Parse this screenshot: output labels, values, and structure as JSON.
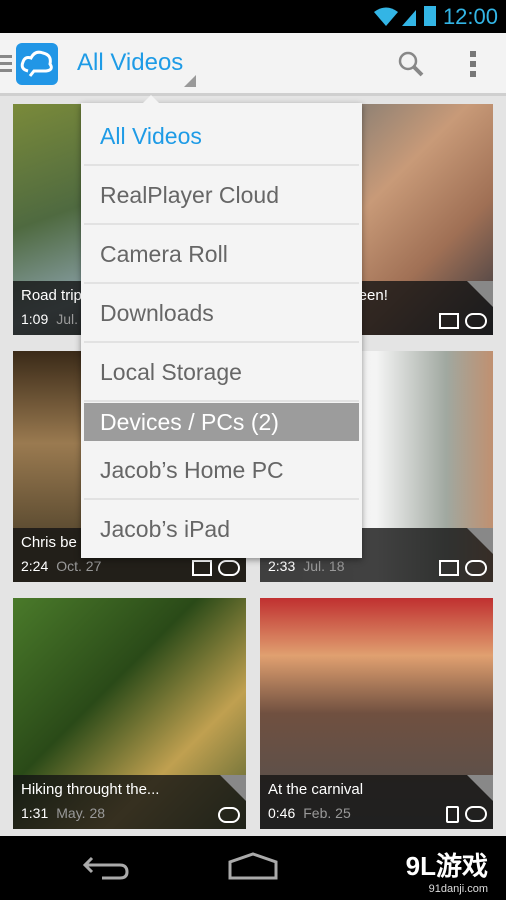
{
  "status": {
    "time": "12:00",
    "icons": [
      "wifi-icon",
      "signal-icon",
      "battery-icon"
    ]
  },
  "actionbar": {
    "title": "All Videos",
    "icons": [
      "menu-icon",
      "cloud-logo-icon",
      "search-icon",
      "overflow-icon"
    ]
  },
  "menu": {
    "items": [
      {
        "label": "All Videos",
        "selected": true
      },
      {
        "label": "RealPlayer Cloud"
      },
      {
        "label": "Camera Roll"
      },
      {
        "label": "Downloads"
      },
      {
        "label": "Local Storage"
      },
      {
        "label": "Devices / PCs (2)",
        "header": true
      },
      {
        "label": "Jacob’s Home PC"
      },
      {
        "label": "Jacob’s iPad"
      }
    ]
  },
  "videos": [
    {
      "title": "Road trip",
      "duration": "1:09",
      "date": "Jul."
    },
    {
      "title": "queen!",
      "duration": "",
      "date": ""
    },
    {
      "title": "Chris be",
      "duration": "2:24",
      "date": "Oct. 27"
    },
    {
      "title": "",
      "duration": "2:33",
      "date": "Jul. 18"
    },
    {
      "title": "Hiking throught the...",
      "duration": "1:31",
      "date": "May. 28"
    },
    {
      "title": "At the carnival",
      "duration": "0:46",
      "date": "Feb. 25"
    }
  ],
  "watermark": {
    "brand": "9L游戏",
    "url": "91danji.com"
  }
}
